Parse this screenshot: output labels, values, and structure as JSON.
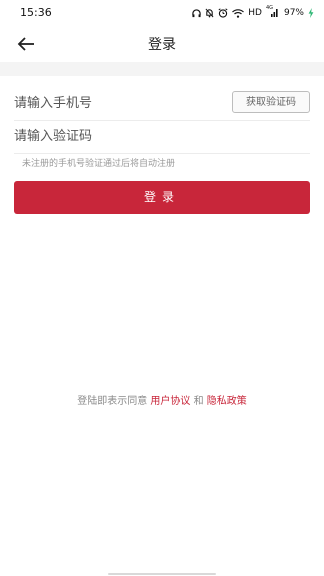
{
  "status_bar": {
    "time": "15:36",
    "network": "HD",
    "signal_label": "4G",
    "battery": "97%",
    "icons": [
      "headphones-icon",
      "bell-off-icon",
      "alarm-icon",
      "wifi-icon",
      "signal-icon",
      "battery-icon",
      "charging-icon"
    ]
  },
  "header": {
    "title": "登录",
    "back_icon": "arrow-left-icon"
  },
  "form": {
    "phone_placeholder": "请输入手机号",
    "phone_value": "",
    "get_code_label": "获取验证码",
    "code_placeholder": "请输入验证码",
    "code_value": "",
    "tip": "未注册的手机号验证通过后将自动注册",
    "login_label": "登录"
  },
  "agreement": {
    "prefix": "登陆即表示同意",
    "user_agreement": "用户协议",
    "and": "和",
    "privacy_policy": "隐私政策"
  },
  "colors": {
    "accent": "#c8263a",
    "background": "#f4f4f4",
    "surface": "#ffffff"
  }
}
